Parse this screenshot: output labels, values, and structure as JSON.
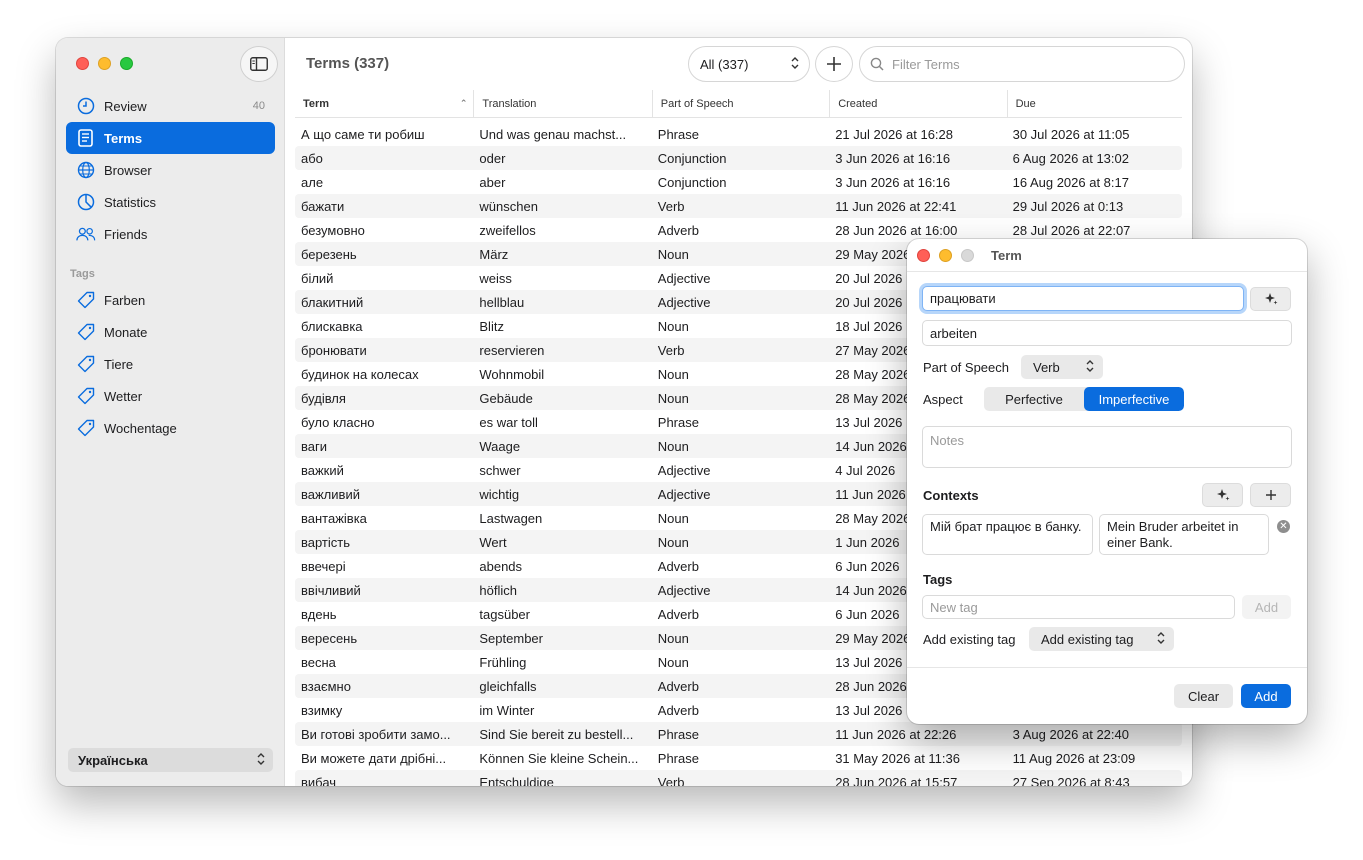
{
  "sidebar": {
    "nav": [
      {
        "label": "Review",
        "badge": "40",
        "icon": "clock-icon"
      },
      {
        "label": "Terms",
        "icon": "book-icon"
      },
      {
        "label": "Browser",
        "icon": "globe-icon"
      },
      {
        "label": "Statistics",
        "icon": "pie-chart-icon"
      },
      {
        "label": "Friends",
        "icon": "people-icon"
      }
    ],
    "tags_label": "Tags",
    "tags": [
      {
        "label": "Farben",
        "icon": "tag-icon"
      },
      {
        "label": "Monate",
        "icon": "tag-icon"
      },
      {
        "label": "Tiere",
        "icon": "tag-icon"
      },
      {
        "label": "Wetter",
        "icon": "tag-icon"
      },
      {
        "label": "Wochentage",
        "icon": "tag-icon"
      }
    ],
    "language": "Українська"
  },
  "toolbar": {
    "title": "Terms (337)",
    "filter": "All (337)",
    "search_placeholder": "Filter Terms"
  },
  "table": {
    "columns": [
      "Term",
      "Translation",
      "Part of Speech",
      "Created",
      "Due"
    ],
    "rows": [
      [
        "А що саме ти робиш",
        "Und was genau machst...",
        "Phrase",
        "21 Jul 2026 at 16:28",
        "30 Jul 2026 at 11:05"
      ],
      [
        "або",
        "oder",
        "Conjunction",
        "3 Jun 2026 at 16:16",
        "6 Aug 2026 at 13:02"
      ],
      [
        "але",
        "aber",
        "Conjunction",
        "3 Jun 2026 at 16:16",
        "16 Aug 2026 at 8:17"
      ],
      [
        "бажати",
        "wünschen",
        "Verb",
        "11 Jun 2026 at 22:41",
        "29 Jul 2026 at 0:13"
      ],
      [
        "безумовно",
        "zweifellos",
        "Adverb",
        "28 Jun 2026 at 16:00",
        "28 Jul 2026 at 22:07"
      ],
      [
        "березень",
        "März",
        "Noun",
        "29 May 2026",
        ""
      ],
      [
        "білий",
        "weiss",
        "Adjective",
        "20 Jul 2026",
        ""
      ],
      [
        "блакитний",
        "hellblau",
        "Adjective",
        "20 Jul 2026",
        ""
      ],
      [
        "блискавка",
        "Blitz",
        "Noun",
        "18 Jul 2026",
        ""
      ],
      [
        "бронювати",
        "reservieren",
        "Verb",
        "27 May 2026",
        ""
      ],
      [
        "будинок на колесах",
        "Wohnmobil",
        "Noun",
        "28 May 2026",
        ""
      ],
      [
        "будівля",
        "Gebäude",
        "Noun",
        "28 May 2026",
        ""
      ],
      [
        "було класно",
        "es war toll",
        "Phrase",
        "13 Jul 2026",
        ""
      ],
      [
        "ваги",
        "Waage",
        "Noun",
        "14 Jun 2026",
        ""
      ],
      [
        "важкий",
        "schwer",
        "Adjective",
        "4 Jul 2026",
        ""
      ],
      [
        "важливий",
        "wichtig",
        "Adjective",
        "11 Jun 2026",
        ""
      ],
      [
        "вантажівка",
        "Lastwagen",
        "Noun",
        "28 May 2026",
        ""
      ],
      [
        "вартість",
        "Wert",
        "Noun",
        "1 Jun 2026",
        ""
      ],
      [
        "ввечері",
        "abends",
        "Adverb",
        "6 Jun 2026",
        ""
      ],
      [
        "ввічливий",
        "höflich",
        "Adjective",
        "14 Jun 2026",
        ""
      ],
      [
        "вдень",
        "tagsüber",
        "Adverb",
        "6 Jun 2026",
        ""
      ],
      [
        "вересень",
        "September",
        "Noun",
        "29 May 2026",
        ""
      ],
      [
        "весна",
        "Frühling",
        "Noun",
        "13 Jul 2026",
        ""
      ],
      [
        "взаємно",
        "gleichfalls",
        "Adverb",
        "28 Jun 2026",
        ""
      ],
      [
        "взимку",
        "im Winter",
        "Adverb",
        "13 Jul 2026",
        ""
      ],
      [
        "Ви готові зробити замо...",
        "Sind Sie bereit zu bestell...",
        "Phrase",
        "11 Jun 2026 at 22:26",
        "3 Aug 2026 at 22:40"
      ],
      [
        "Ви можете дати дрібні...",
        "Können Sie kleine Schein...",
        "Phrase",
        "31 May 2026 at 11:36",
        "11 Aug 2026 at 23:09"
      ],
      [
        "вибач",
        "Entschuldige",
        "Verb",
        "28 Jun 2026 at 15:57",
        "27 Sep 2026 at 8:43"
      ]
    ]
  },
  "term_panel": {
    "title": "Term",
    "term_value": "працювати",
    "translation_value": "arbeiten",
    "pos_label": "Part of Speech",
    "pos_value": "Verb",
    "aspect_label": "Aspect",
    "aspect_options": [
      "Perfective",
      "Imperfective"
    ],
    "aspect_selected": "Imperfective",
    "notes_placeholder": "Notes",
    "contexts_label": "Contexts",
    "contexts": [
      {
        "source": "Мій брат працює в банку.",
        "target": "Mein Bruder arbeitet in einer Bank."
      }
    ],
    "tags_label": "Tags",
    "new_tag_placeholder": "New tag",
    "add_tag_label": "Add",
    "existing_tag_label": "Add existing tag",
    "existing_tag_select": "Add existing tag",
    "clear_label": "Clear",
    "add_label": "Add"
  }
}
